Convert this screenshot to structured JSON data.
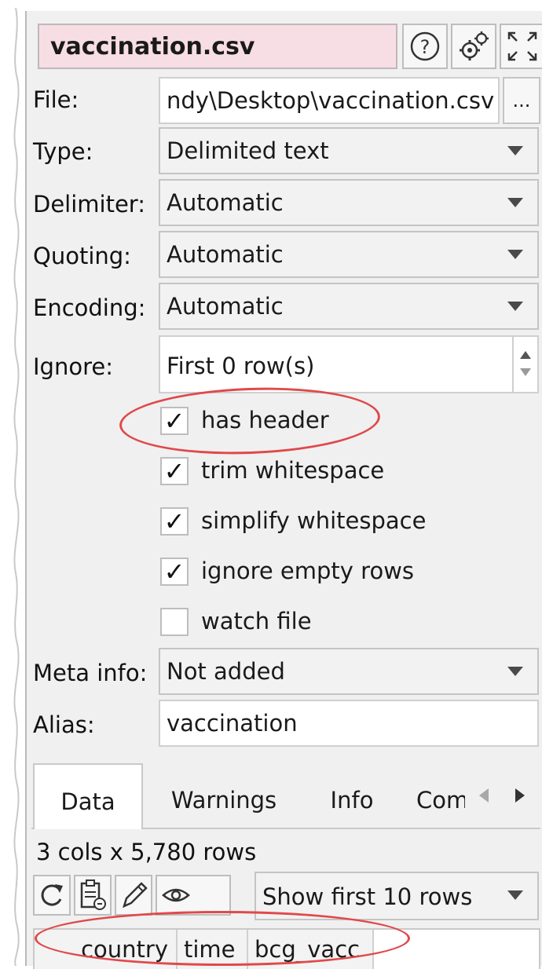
{
  "header": {
    "title": "vaccination.csv"
  },
  "fields": {
    "file_label": "File:",
    "file_value": "ndy\\Desktop\\vaccination.csv",
    "browse_label": "...",
    "type_label": "Type:",
    "type_value": "Delimited text",
    "delimiter_label": "Delimiter:",
    "delimiter_value": "Automatic",
    "quoting_label": "Quoting:",
    "quoting_value": "Automatic",
    "encoding_label": "Encoding:",
    "encoding_value": "Automatic",
    "ignore_label": "Ignore:",
    "ignore_value": "First 0 row(s)",
    "meta_label": "Meta info:",
    "meta_value": "Not added",
    "alias_label": "Alias:",
    "alias_value": "vaccination"
  },
  "options": [
    {
      "label": "has header",
      "checked": true,
      "mark": "✓"
    },
    {
      "label": "trim whitespace",
      "checked": true,
      "mark": "✓"
    },
    {
      "label": "simplify whitespace",
      "checked": true,
      "mark": "✓"
    },
    {
      "label": "ignore empty rows",
      "checked": true,
      "mark": "✓"
    },
    {
      "label": "watch file",
      "checked": false,
      "mark": ""
    }
  ],
  "tabs": [
    {
      "label": "Data",
      "active": true
    },
    {
      "label": "Warnings",
      "active": false
    },
    {
      "label": "Info",
      "active": false
    },
    {
      "label": "Com",
      "active": false
    }
  ],
  "data_panel": {
    "summary": "3 cols x 5,780 rows",
    "show_rows": "Show first 10 rows",
    "columns": [
      "country",
      "time",
      "bcg_vacc"
    ]
  },
  "icons": {
    "help": "help-icon",
    "settings": "gears-icon",
    "maximize": "maximize-icon",
    "refresh": "refresh-icon",
    "clipboard": "clipboard-icon",
    "edit": "pencil-icon",
    "view": "eye-icon"
  },
  "colors": {
    "title_background": "#f7dee4",
    "annotation": "#e0494b",
    "panel": "#f0f0f0"
  }
}
